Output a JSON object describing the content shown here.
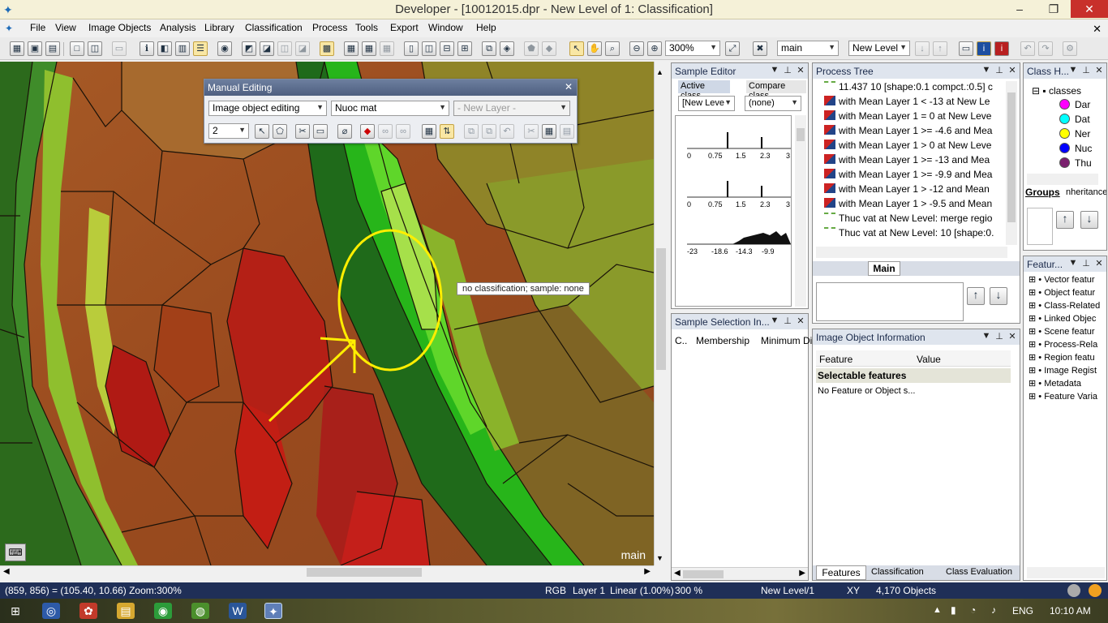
{
  "window": {
    "title": "Developer - [10012015.dpr - New Level of 1: Classification]",
    "min": "–",
    "max": "❐",
    "close": "✕"
  },
  "menu": [
    "File",
    "View",
    "Image Objects",
    "Analysis",
    "Library",
    "Classification",
    "Process",
    "Tools",
    "Export",
    "Window",
    "Help"
  ],
  "toolbar": {
    "zoom": "300%",
    "map": "main",
    "level": "New Level",
    "close_doc": "✕"
  },
  "viewer": {
    "label": "main",
    "tooltip": "no classification;  sample: none"
  },
  "manual_editing": {
    "title": "Manual Editing",
    "mode": "Image object editing",
    "class": "Nuoc mat",
    "layer": "- New Layer -",
    "size": "2"
  },
  "sample_editor": {
    "title": "Sample Editor",
    "active_class": "Active class",
    "compare_class": "Compare class",
    "active_value": "[New Leve",
    "compare_value": "(none)",
    "axis1": [
      "0",
      "0.75",
      "1.5",
      "2.3",
      "3"
    ],
    "axis2": [
      "0",
      "0.75",
      "1.5",
      "2.3",
      "3"
    ],
    "axis3": [
      "-23",
      "-18.6",
      "-14.3",
      "-9.9"
    ]
  },
  "process_tree": {
    "title": "Process Tree",
    "rows": [
      "11.437    10 [shape:0.1 compct.:0.5] c",
      "with Mean Layer 1 < -13  at  New Le",
      "with Mean Layer 1 = 0  at  New Leve",
      "with Mean Layer 1 >= -4.6  and Mea",
      "with Mean Layer 1 > 0  at  New Leve",
      "with Mean Layer 1 >= -13  and Mea",
      "with Mean Layer 1 >= -9.9  and Mea",
      "with Mean Layer 1 > -12  and Mean",
      "with Mean Layer 1 > -9.5  and Mean",
      "Thuc vat at  New Level: merge regio",
      "Thuc vat at  New Level: 10 [shape:0."
    ],
    "tab": "Main"
  },
  "class_hierarchy": {
    "title": "Class H...",
    "root": "classes",
    "classes": [
      {
        "name": "Dar",
        "color": "#ff00ff"
      },
      {
        "name": "Dat",
        "color": "#00ffff"
      },
      {
        "name": "Ner",
        "color": "#ffff00"
      },
      {
        "name": "Nuc",
        "color": "#0000ff"
      },
      {
        "name": "Thu",
        "color": "#7a1f6e"
      }
    ],
    "tab_groups": "Groups",
    "tab_inheritance": "nheritance"
  },
  "feature_view": {
    "title": "Featur...",
    "items": [
      "Vector featur",
      "Object featur",
      "Class-Related",
      "Linked Objec",
      "Scene featur",
      "Process-Rela",
      "Region featu",
      "Image Regist",
      "Metadata",
      "Feature Varia"
    ]
  },
  "sample_selection": {
    "title": "Sample Selection In...",
    "cols": [
      "C..",
      "Membership",
      "Minimum Dis"
    ]
  },
  "image_object_info": {
    "title": "Image Object Information",
    "col_feature": "Feature",
    "col_value": "Value",
    "group": "Selectable features",
    "empty": "No Feature or Object s...",
    "tabs": [
      "Features",
      "Classification",
      "Class Evaluation"
    ]
  },
  "status": {
    "coords": "(859, 856) = (105.40, 10.66)  Zoom:300%",
    "mode": "RGB",
    "layer": "Layer 1",
    "stretch": "Linear (1.00%)",
    "zoom": "300 %",
    "level": "New Level/1",
    "xy": "XY",
    "objects": "4,170 Objects"
  },
  "taskbar": {
    "lang": "ENG",
    "time": "10:10 AM"
  }
}
